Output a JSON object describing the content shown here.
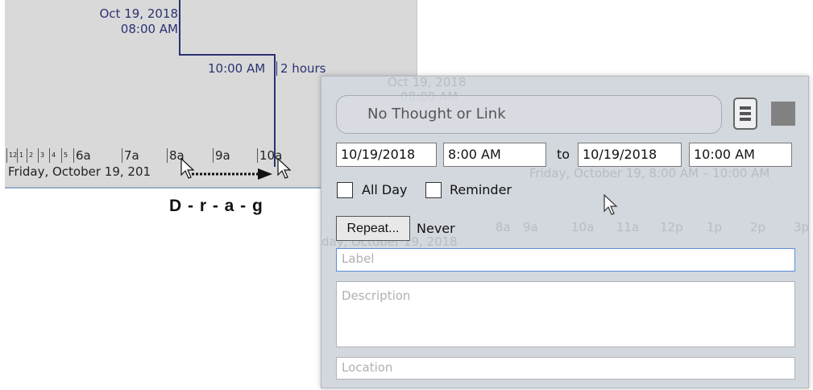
{
  "timeline": {
    "start_date": "Oct 19, 2018",
    "start_time": "08:00 AM",
    "end_time": "10:00 AM",
    "duration": "2 hours",
    "small_ticks": [
      "12",
      "1",
      "2",
      "3",
      "4",
      "5"
    ],
    "hour_ticks": [
      "6a",
      "7a",
      "8a",
      "9a",
      "10a"
    ],
    "day_label": "Friday, October 19, 201",
    "drag_caption": "D - r - a - g"
  },
  "editor": {
    "thought_placeholder": "No Thought or Link",
    "start_date": "10/19/2018",
    "start_time": "8:00 AM",
    "to_label": "to",
    "end_date": "10/19/2018",
    "end_time": "10:00 AM",
    "all_day_label": "All Day",
    "reminder_label": "Reminder",
    "repeat_label": "Repeat...",
    "repeat_value": "Never",
    "label_placeholder": "Label",
    "description_placeholder": "Description",
    "location_placeholder": "Location",
    "background": {
      "date": "Oct 19, 2018",
      "time": "08:00 AM",
      "event_range": "Friday, October 19, 8:00 AM – 10:00 AM",
      "hour_ticks": [
        "8a",
        "9a",
        "10a",
        "11a",
        "12p",
        "1p",
        "2p",
        "3p"
      ],
      "day_fragment": "day, October 19, 2018"
    }
  },
  "colors": {
    "timeline_line": "#2b3272",
    "panel_bg": "#d3d7de",
    "focus_border": "#5a8ed6"
  }
}
